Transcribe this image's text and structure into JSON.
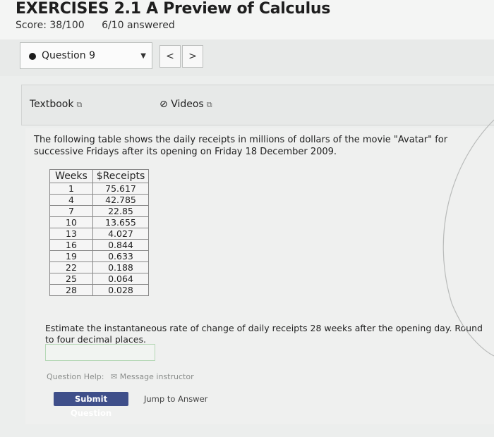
{
  "header": {
    "title": "EXERCISES 2.1 A Preview of Calculus",
    "score": "Score: 38/100",
    "answered": "6/10 answered"
  },
  "question_nav": {
    "selected": "Question 9",
    "prev": "<",
    "next": ">"
  },
  "resources": {
    "textbook": "Textbook",
    "videos": "Videos"
  },
  "problem": {
    "intro": "The following table shows the daily receipts in millions of dollars of the movie \"Avatar\" for successive Fridays after its opening on Friday 18 December 2009.",
    "question": "Estimate the instantaneous rate of change of daily receipts 28 weeks after the opening day. Round to four decimal places.",
    "answer_value": ""
  },
  "table": {
    "headers": [
      "Weeks",
      "$Receipts"
    ],
    "rows": [
      [
        "1",
        "75.617"
      ],
      [
        "4",
        "42.785"
      ],
      [
        "7",
        "22.85"
      ],
      [
        "10",
        "13.655"
      ],
      [
        "13",
        "4.027"
      ],
      [
        "16",
        "0.844"
      ],
      [
        "19",
        "0.633"
      ],
      [
        "22",
        "0.188"
      ],
      [
        "25",
        "0.064"
      ],
      [
        "28",
        "0.028"
      ]
    ]
  },
  "footer": {
    "help_label": "Question Help:",
    "message": "Message instructor",
    "submit": "Submit Question",
    "jump": "Jump to Answer"
  },
  "icons": {
    "external": "external-link-icon",
    "video": "video-icon",
    "mail": "mail-icon",
    "dropdown": "chevron-down-icon"
  }
}
